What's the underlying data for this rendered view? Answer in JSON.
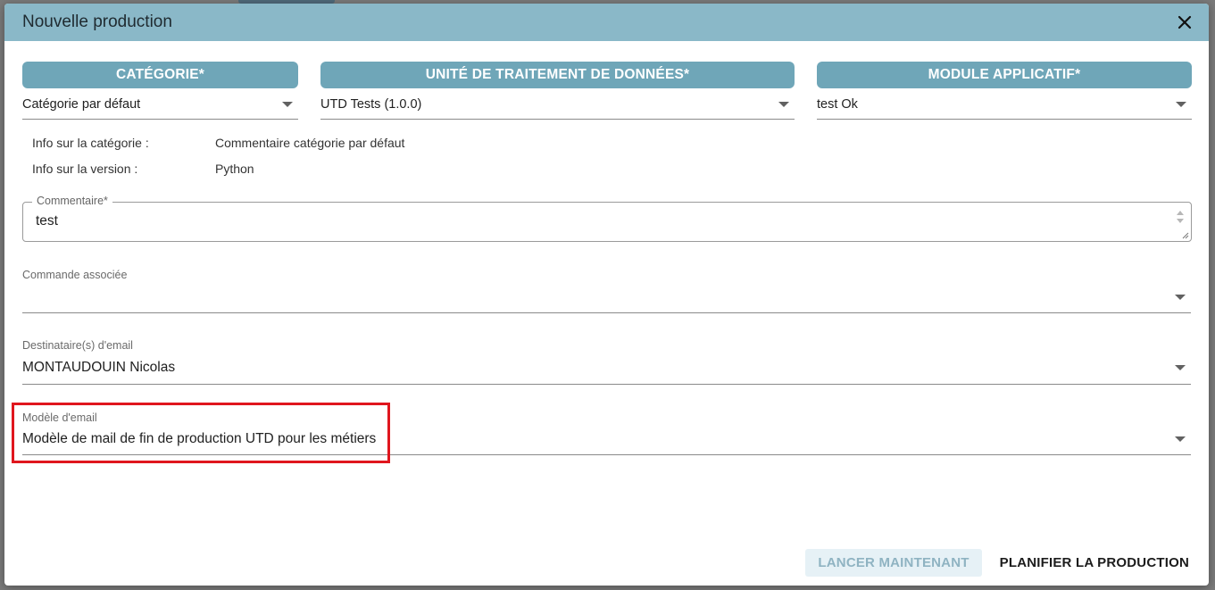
{
  "dialog": {
    "title": "Nouvelle production",
    "close_icon": "close-icon"
  },
  "columns": [
    {
      "header": "CATÉGORIE*",
      "value": "Catégorie par défaut"
    },
    {
      "header": "UNITÉ DE TRAITEMENT DE DONNÉES*",
      "value": "UTD Tests (1.0.0)"
    },
    {
      "header": "MODULE APPLICATIF*",
      "value": "test Ok"
    }
  ],
  "info": {
    "category_label": "Info sur la catégorie :",
    "category_value": "Commentaire catégorie par défaut",
    "version_label": "Info sur la version :",
    "version_value": "Python"
  },
  "comment": {
    "label": "Commentaire*",
    "value": "test"
  },
  "commande": {
    "label": "Commande associée",
    "value": ""
  },
  "destinataires": {
    "label": "Destinataire(s) d'email",
    "value": "MONTAUDOUIN Nicolas"
  },
  "modele": {
    "label": "Modèle d'email",
    "value": "Modèle de mail de fin de production UTD pour les métiers"
  },
  "actions": {
    "launch_now": "LANCER MAINTENANT",
    "schedule": "PLANIFIER LA PRODUCTION"
  },
  "colors": {
    "header_bg": "#8ab8c8",
    "column_header_bg": "#6fa6b8",
    "highlight": "#e0161e"
  }
}
